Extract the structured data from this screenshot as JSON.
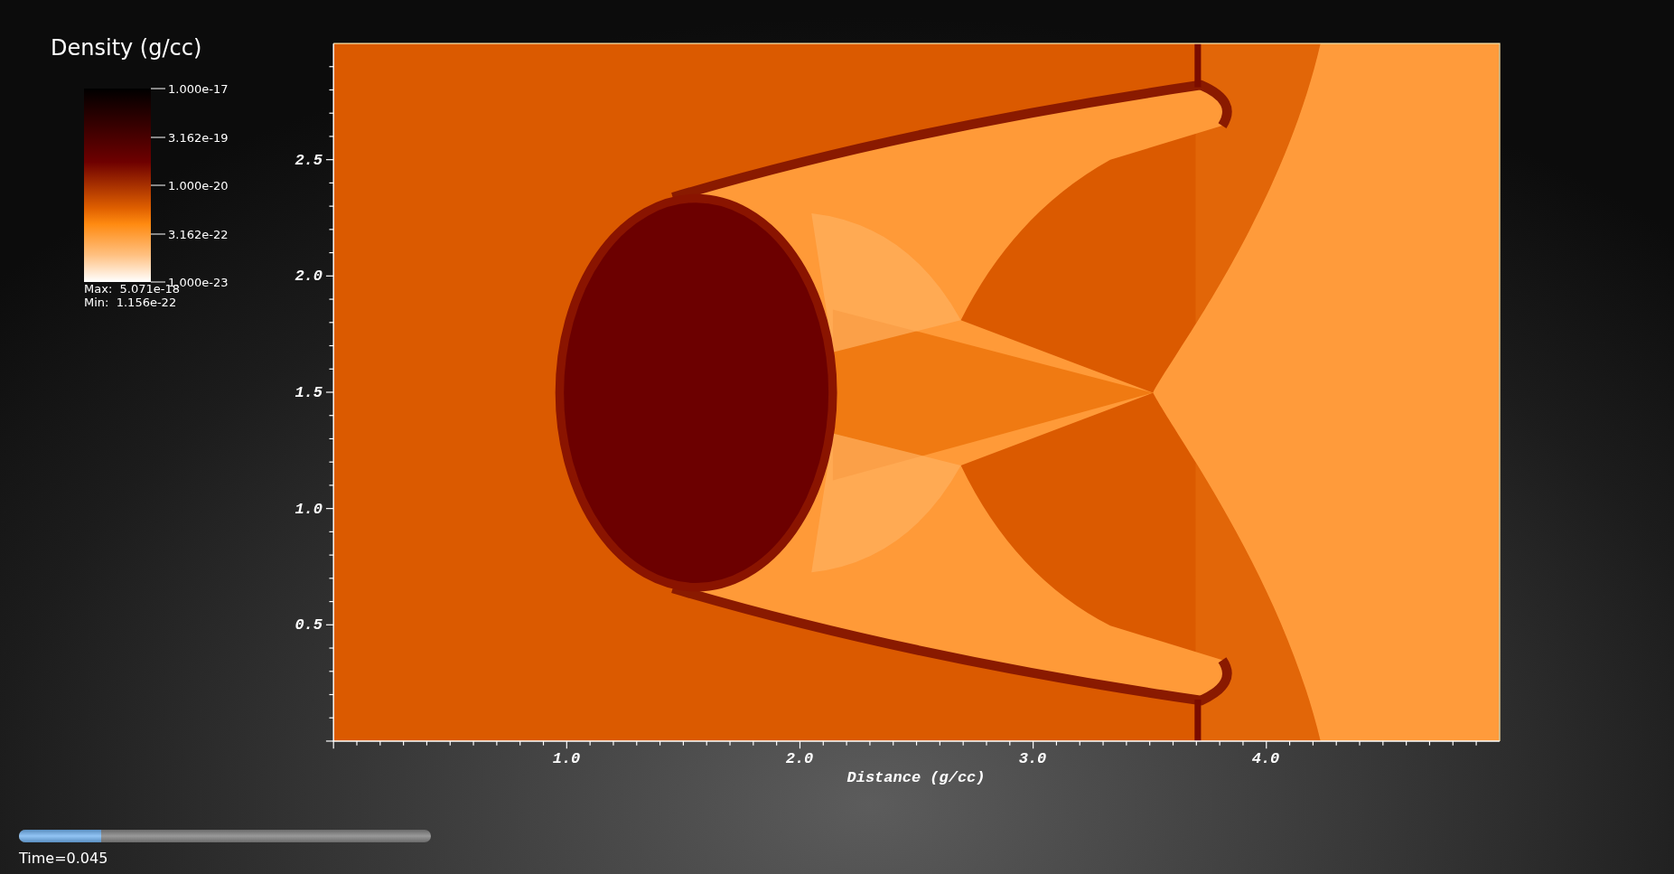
{
  "legend": {
    "title": "Density (g/cc)",
    "ticks": [
      "1.000e-17",
      "3.162e-19",
      "1.000e-20",
      "3.162e-22",
      "1.000e-23"
    ],
    "max": "Max:  5.071e-18",
    "min": "Min:  1.156e-22"
  },
  "plot": {
    "x_axis": {
      "label": "Distance (g/cc)",
      "ticks": [
        "1.0",
        "2.0",
        "3.0",
        "4.0"
      ]
    },
    "y_axis": {
      "ticks": [
        "2.5",
        "2.0",
        "1.5",
        "1.0",
        "0.5"
      ]
    }
  },
  "time_slider": {
    "level": 0.2,
    "label": "Time=0.045"
  }
}
